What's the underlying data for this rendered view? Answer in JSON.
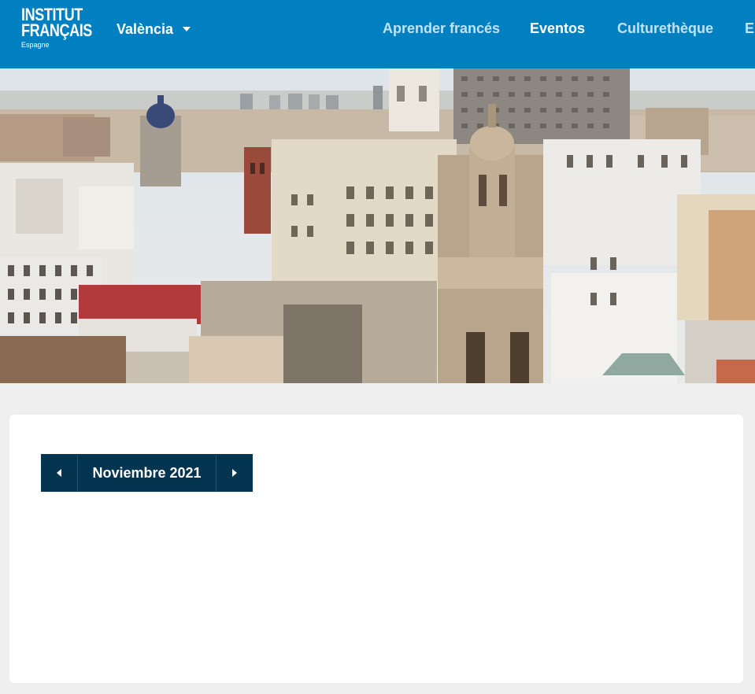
{
  "header": {
    "background": "#0080c0",
    "logo": {
      "line1": "INSTITUT",
      "line2": "FRANÇAIS",
      "sub": "Espagne"
    },
    "city": {
      "selected": "València",
      "icon": "chevron-down-icon"
    },
    "nav": [
      {
        "label": "Aprender francés",
        "color": "#bfe3f6"
      },
      {
        "label": "Eventos",
        "color": "#ffffff"
      },
      {
        "label": "Culturethèque",
        "color": "#bfe3f6"
      },
      {
        "label": "El",
        "color": "#bfe3f6"
      }
    ]
  },
  "hero": {
    "description_icon": "city-skyline-image"
  },
  "calendar": {
    "month_label": "Noviembre 2021",
    "prev_icon": "caret-left-icon",
    "next_icon": "caret-right-icon",
    "nav_background": "#033550"
  }
}
